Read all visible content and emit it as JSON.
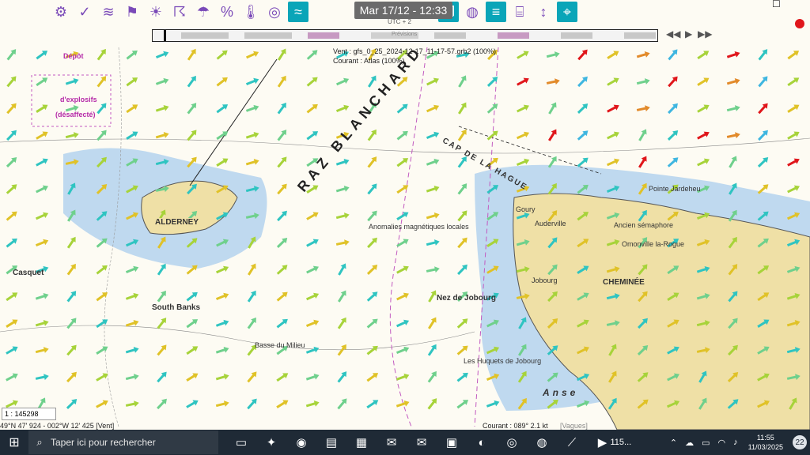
{
  "toolbar": {
    "datetime": "Mar 17/12 - 12:33",
    "utc_offset": "UTC + 2",
    "icons": [
      "settings-icon",
      "route-icon",
      "wind-icon",
      "windsock-icon",
      "weather-sun-icon",
      "storm-icon",
      "rain-icon",
      "percent-icon",
      "thermometer-icon",
      "swirl-icon",
      "waves-icon",
      "layers-icon",
      "globe-icon",
      "database-icon",
      "map-icon",
      "height-icon",
      "location-icon"
    ]
  },
  "timeline": {
    "label": "Prévisions",
    "progress": 0.02
  },
  "grib": {
    "wind_line": "Vent : gfs_0_25_2024-12-17_11-17-57.grb2 (100%)",
    "current_line": "Courant : Atlas (100%)"
  },
  "status": {
    "scale": "1 : 145298",
    "position": "49°N 47' 924 - 002°W 12' 425",
    "mode": "[Vent]",
    "current_readout": "Courant : 089° 2.1 kt",
    "waves": "[Vagues]"
  },
  "chart_labels": {
    "alderney": "ALDERNEY",
    "raz": "RAZ BLANCHARD",
    "cap": "CAP DE LA HAGUE",
    "nez": "Nez de Jobourg",
    "depot": "Dépôt",
    "explosifs": "d'explosifs",
    "desaffecte": "(désaffecté)",
    "casquet": "Casquet",
    "south_banks": "South Banks",
    "basse_milieu": "Basse du Milieu",
    "jobourg": "Jobourg",
    "cheminee": "CHEMINÉE",
    "auderville": "Auderville",
    "goury": "Goury",
    "anse": "Anse",
    "omonville": "Omonville la-Rogue",
    "pointe_jardeheu": "Pointe Jardeheu",
    "anomalies": "Anomalies magnétiques locales",
    "huquets": "Les Huquets de Jobourg",
    "semaphore": "Ancien sémaphore"
  },
  "taskbar": {
    "search_placeholder": "Taper ici pour rechercher",
    "active_app": "115...",
    "time": "11:55",
    "date": "11/03/2025",
    "notifications": "22"
  },
  "colors": {
    "land": "#efe0a6",
    "shallow": "#bfd9ef",
    "sea": "#fdfbf3",
    "accent": "#0aa5b8",
    "taskbar": "#1f2a36"
  }
}
